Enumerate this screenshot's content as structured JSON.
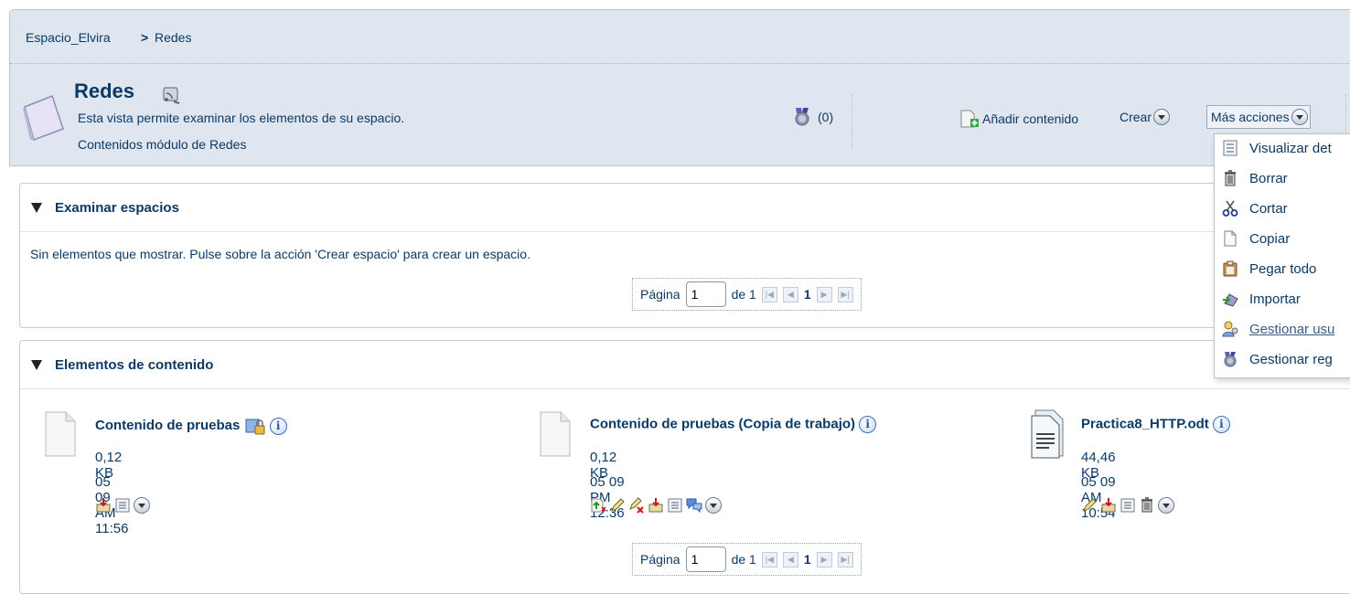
{
  "breadcrumb": {
    "root": "Espacio_Elvira",
    "separator": ">",
    "current": "Redes"
  },
  "space": {
    "title": "Redes",
    "description": "Esta vista permite examinar los elementos de su espacio.",
    "subtitle": "Contenidos módulo de Redes",
    "rules_count": "(0)"
  },
  "toolbar": {
    "add_content": "Añadir contenido",
    "create": "Crear",
    "more_actions": "Más acciones"
  },
  "more_actions_menu": [
    {
      "label": "Visualizar det",
      "icon": "details-icon"
    },
    {
      "label": "Borrar",
      "icon": "trash-icon"
    },
    {
      "label": "Cortar",
      "icon": "scissors-icon"
    },
    {
      "label": "Copiar",
      "icon": "copy-icon"
    },
    {
      "label": "Pegar todo",
      "icon": "paste-icon"
    },
    {
      "label": "Importar",
      "icon": "import-icon"
    },
    {
      "label": "Gestionar usu",
      "icon": "manage-users-icon"
    },
    {
      "label": "Gestionar reg",
      "icon": "manage-rules-icon"
    }
  ],
  "browse_spaces": {
    "title": "Examinar espacios",
    "empty_message": "Sin elementos que mostrar. Pulse sobre la acción 'Crear espacio' para crear un espacio.",
    "pager": {
      "label": "Página",
      "value": "1",
      "of": "de 1",
      "current": "1"
    }
  },
  "content_items": {
    "title": "Elementos de contenido",
    "items": [
      {
        "name": "Contenido de pruebas",
        "size": "0,12 KB",
        "date": "05 09 AM 11:56"
      },
      {
        "name": "Contenido de pruebas (Copia de trabajo)",
        "size": "0,12 KB",
        "date": "05 09 PM 12:36"
      },
      {
        "name": "Practica8_HTTP.odt",
        "size": "44,46 KB",
        "date": "05 09 AM 10:54"
      }
    ],
    "pager": {
      "label": "Página",
      "value": "1",
      "of": "de 1",
      "current": "1"
    }
  },
  "colors": {
    "header_bg": "#dfe6ef",
    "text": "#0b3a66",
    "border": "#c4ccd6"
  }
}
